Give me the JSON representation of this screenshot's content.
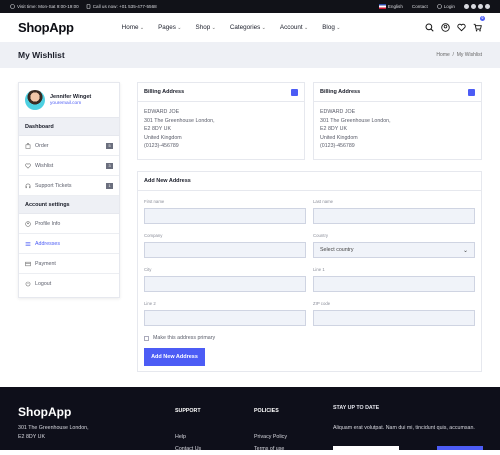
{
  "topbar": {
    "hours": "Visit time: Mon-Sat 9:00-19:00",
    "phone": "Call us now: +01 535-477-5568",
    "language": "English",
    "contact": "Contact",
    "login": "Login"
  },
  "header": {
    "logo": "ShopApp",
    "nav": [
      "Home",
      "Pages",
      "Shop",
      "Categories",
      "Account",
      "Blog"
    ],
    "cart_count": "0"
  },
  "page": {
    "title": "My Wishlist",
    "breadcrumb": [
      "Home",
      "My Wishlist"
    ]
  },
  "sidebar": {
    "name": "Jennifer Winget",
    "email": "youremail.com",
    "dashboard_heading": "Dashboard",
    "dashboard_items": [
      {
        "label": "Order",
        "count": "5"
      },
      {
        "label": "Wishlist",
        "count": "3"
      },
      {
        "label": "Support Tickets",
        "count": "1"
      }
    ],
    "account_heading": "Account settings",
    "account_items": [
      {
        "label": "Profile Info"
      },
      {
        "label": "Addresses"
      },
      {
        "label": "Payment"
      },
      {
        "label": "Logout"
      }
    ]
  },
  "billing": [
    {
      "title": "Billing Address",
      "lines": [
        "EDWARD JOE",
        "301 The Greenhouse London,",
        "E2 8DY UK",
        "United Kingdom",
        "(0123)-456789"
      ]
    },
    {
      "title": "Billing Address",
      "lines": [
        "EDWARD JOE",
        "301 The Greenhouse London,",
        "E2 8DY UK",
        "United Kingdom",
        "(0123)-456789"
      ]
    }
  ],
  "form": {
    "title": "Add New Address",
    "first_name": "First name",
    "last_name": "Last name",
    "company": "Company",
    "country": "Country",
    "country_value": "Select country",
    "city": "City",
    "line1": "Line 1",
    "line2": "Line 2",
    "zip": "ZIP code",
    "primary": "Make this address primary",
    "submit": "Add New Address"
  },
  "footer": {
    "logo": "ShopApp",
    "address": [
      "301 The Greenhouse London,",
      "E2 8DY UK"
    ],
    "support_heading": "SUPPORT",
    "support_links": [
      "Help",
      "Contact Us"
    ],
    "policies_heading": "POLICIES",
    "policies_links": [
      "Privacy Policy",
      "Terms of use"
    ],
    "stay_heading": "STAY UP TO DATE",
    "stay_text": "Aliquam erat volutpat. Nam dui mi, tincidunt quis, accumsan."
  },
  "colors": {
    "accent": "#4c5cf5",
    "dark": "#111218",
    "light_bg": "#eef0f5"
  }
}
